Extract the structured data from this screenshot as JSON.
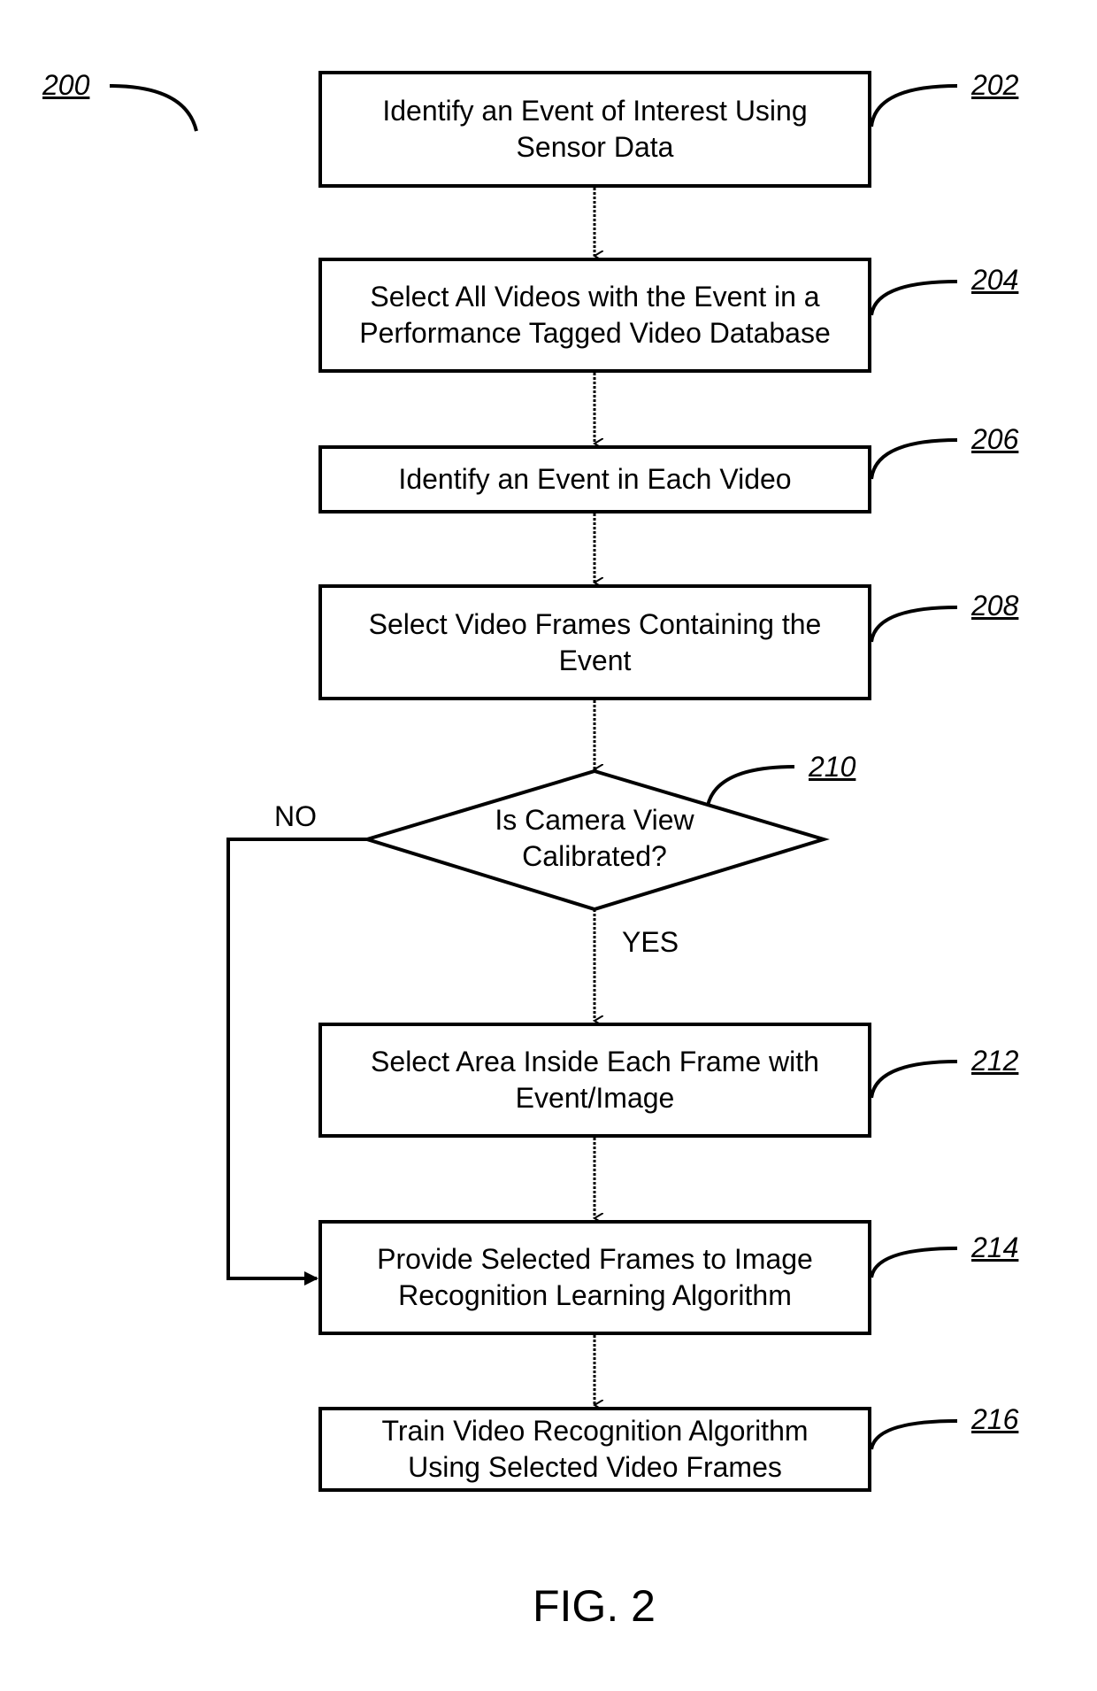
{
  "figure": {
    "title": "FIG. 2",
    "ref": "200"
  },
  "steps": [
    {
      "ref": "202",
      "text": "Identify an Event of Interest Using\nSensor Data"
    },
    {
      "ref": "204",
      "text": "Select All Videos with the Event in a\nPerformance Tagged Video Database"
    },
    {
      "ref": "206",
      "text": "Identify an Event in Each Video"
    },
    {
      "ref": "208",
      "text": "Select Video Frames Containing the\nEvent"
    },
    {
      "ref": "212",
      "text": "Select Area Inside Each Frame with\nEvent/Image"
    },
    {
      "ref": "214",
      "text": "Provide Selected Frames to Image\nRecognition Learning Algorithm"
    },
    {
      "ref": "216",
      "text": "Train Video Recognition Algorithm\nUsing Selected Video Frames"
    }
  ],
  "decision": {
    "ref": "210",
    "text": "Is Camera View\nCalibrated?",
    "yes_label": "YES",
    "no_label": "NO"
  }
}
